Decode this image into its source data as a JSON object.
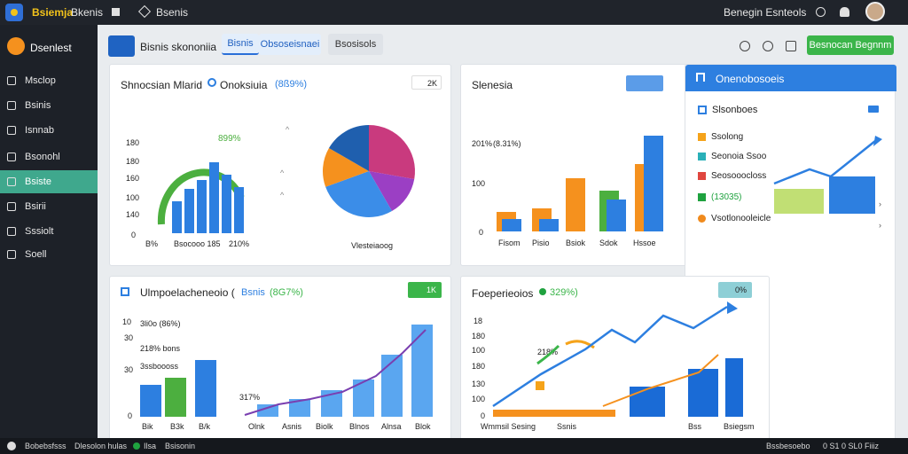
{
  "titlebar": {
    "app_name": "Bsiemja",
    "tab1": "Bkenis",
    "tab2": "Bsenis",
    "right_text": "Benegin  Esnteols"
  },
  "sidebar": {
    "brand": "Dsenlest",
    "items": [
      {
        "label": "Msclop",
        "icon": "home-icon"
      },
      {
        "label": "Bsinis",
        "icon": "document-icon"
      },
      {
        "label": "Isnnab",
        "icon": "list-icon"
      },
      {
        "label": "Bsonohl",
        "icon": "folder-icon"
      },
      {
        "label": "Bsiste",
        "icon": "chart-icon",
        "active": true
      },
      {
        "label": "Bsirii",
        "icon": "pen-icon"
      },
      {
        "label": "Sssiolt",
        "icon": "grid-icon"
      },
      {
        "label": "Soell",
        "icon": "wrench-icon"
      }
    ]
  },
  "header": {
    "title": "Bisnis skononiia",
    "tabs": [
      "Bisnis",
      "Obsoseisnaei",
      "Bsosisols"
    ],
    "action_button": "Besnocan Begnnm"
  },
  "card1": {
    "title": "Shnocsian Mlarid",
    "subtitle": "Onoksiuia",
    "subtitle_value": "(8ß9%)",
    "dropdown": "2K",
    "gauge_label": "899%",
    "y_ticks": [
      "180",
      "180",
      "160",
      "100",
      "140",
      "0"
    ],
    "x_labels": [
      "B%",
      "Bsocooo 185",
      "210%"
    ],
    "pie_label": "Vlesteiaoog"
  },
  "card2": {
    "title": "Slenesia",
    "badge": "",
    "y_ticks": [
      "201%",
      "100",
      "0"
    ],
    "annotation": "(8.31%)",
    "x_labels": [
      "Fisom",
      "Pisio",
      "Bsiok",
      "Sdok",
      "Hssoe"
    ]
  },
  "panel": {
    "title": "Onenobosoeis",
    "subtitle": "Slsonboes",
    "legend": [
      {
        "label": "Ssolong",
        "color": "#f5a31a"
      },
      {
        "label": "Seonoia Ssoo",
        "color": "#2ab0b8"
      },
      {
        "label": "Seosooocloss",
        "color": "#e0463f"
      },
      {
        "label": "(13035)",
        "color": "#1fa23f"
      },
      {
        "label": "Vsotlonooleicle",
        "color": "#f08a1c"
      }
    ]
  },
  "card3": {
    "title": "Ulmpoelacheneoio (",
    "title_highlight": "Bsnis",
    "title_value": "(8G7%)",
    "badge": "1K",
    "labels": [
      "3li0o (86%)",
      "218% bons",
      "3ssboooss"
    ],
    "y_ticks": [
      "10",
      "30",
      "30",
      "0"
    ],
    "line_label": "317%",
    "x_labels": [
      "Bik",
      "B3k",
      "B/k",
      "Olnk",
      "Asnis",
      "Biolk",
      "Blnos",
      "Alnsa",
      "Blok"
    ]
  },
  "card4": {
    "title": "Foeperieoios",
    "title_value": "329%)",
    "badge": "0%",
    "y_ticks": [
      "18",
      "180",
      "100",
      "180",
      "130",
      "100",
      "0"
    ],
    "annotation": "218%",
    "x_labels": [
      "Wmmsil Sesing",
      "Ssnis",
      "Bss",
      "Bsiegsm"
    ]
  },
  "statusbar": {
    "left": [
      "Bobebsfsss",
      "Dlesolon hulas",
      "Ilsa",
      "Bsisonin"
    ],
    "right": [
      "Bssbesoebo",
      "0 S1 0 SL0 Fiiiz"
    ]
  },
  "colors": {
    "accent": "#2f6fd6",
    "sidebar_active": "#3fa88d",
    "green": "#4caf3f",
    "orange": "#f5911e",
    "blue": "#2d7fe0"
  }
}
